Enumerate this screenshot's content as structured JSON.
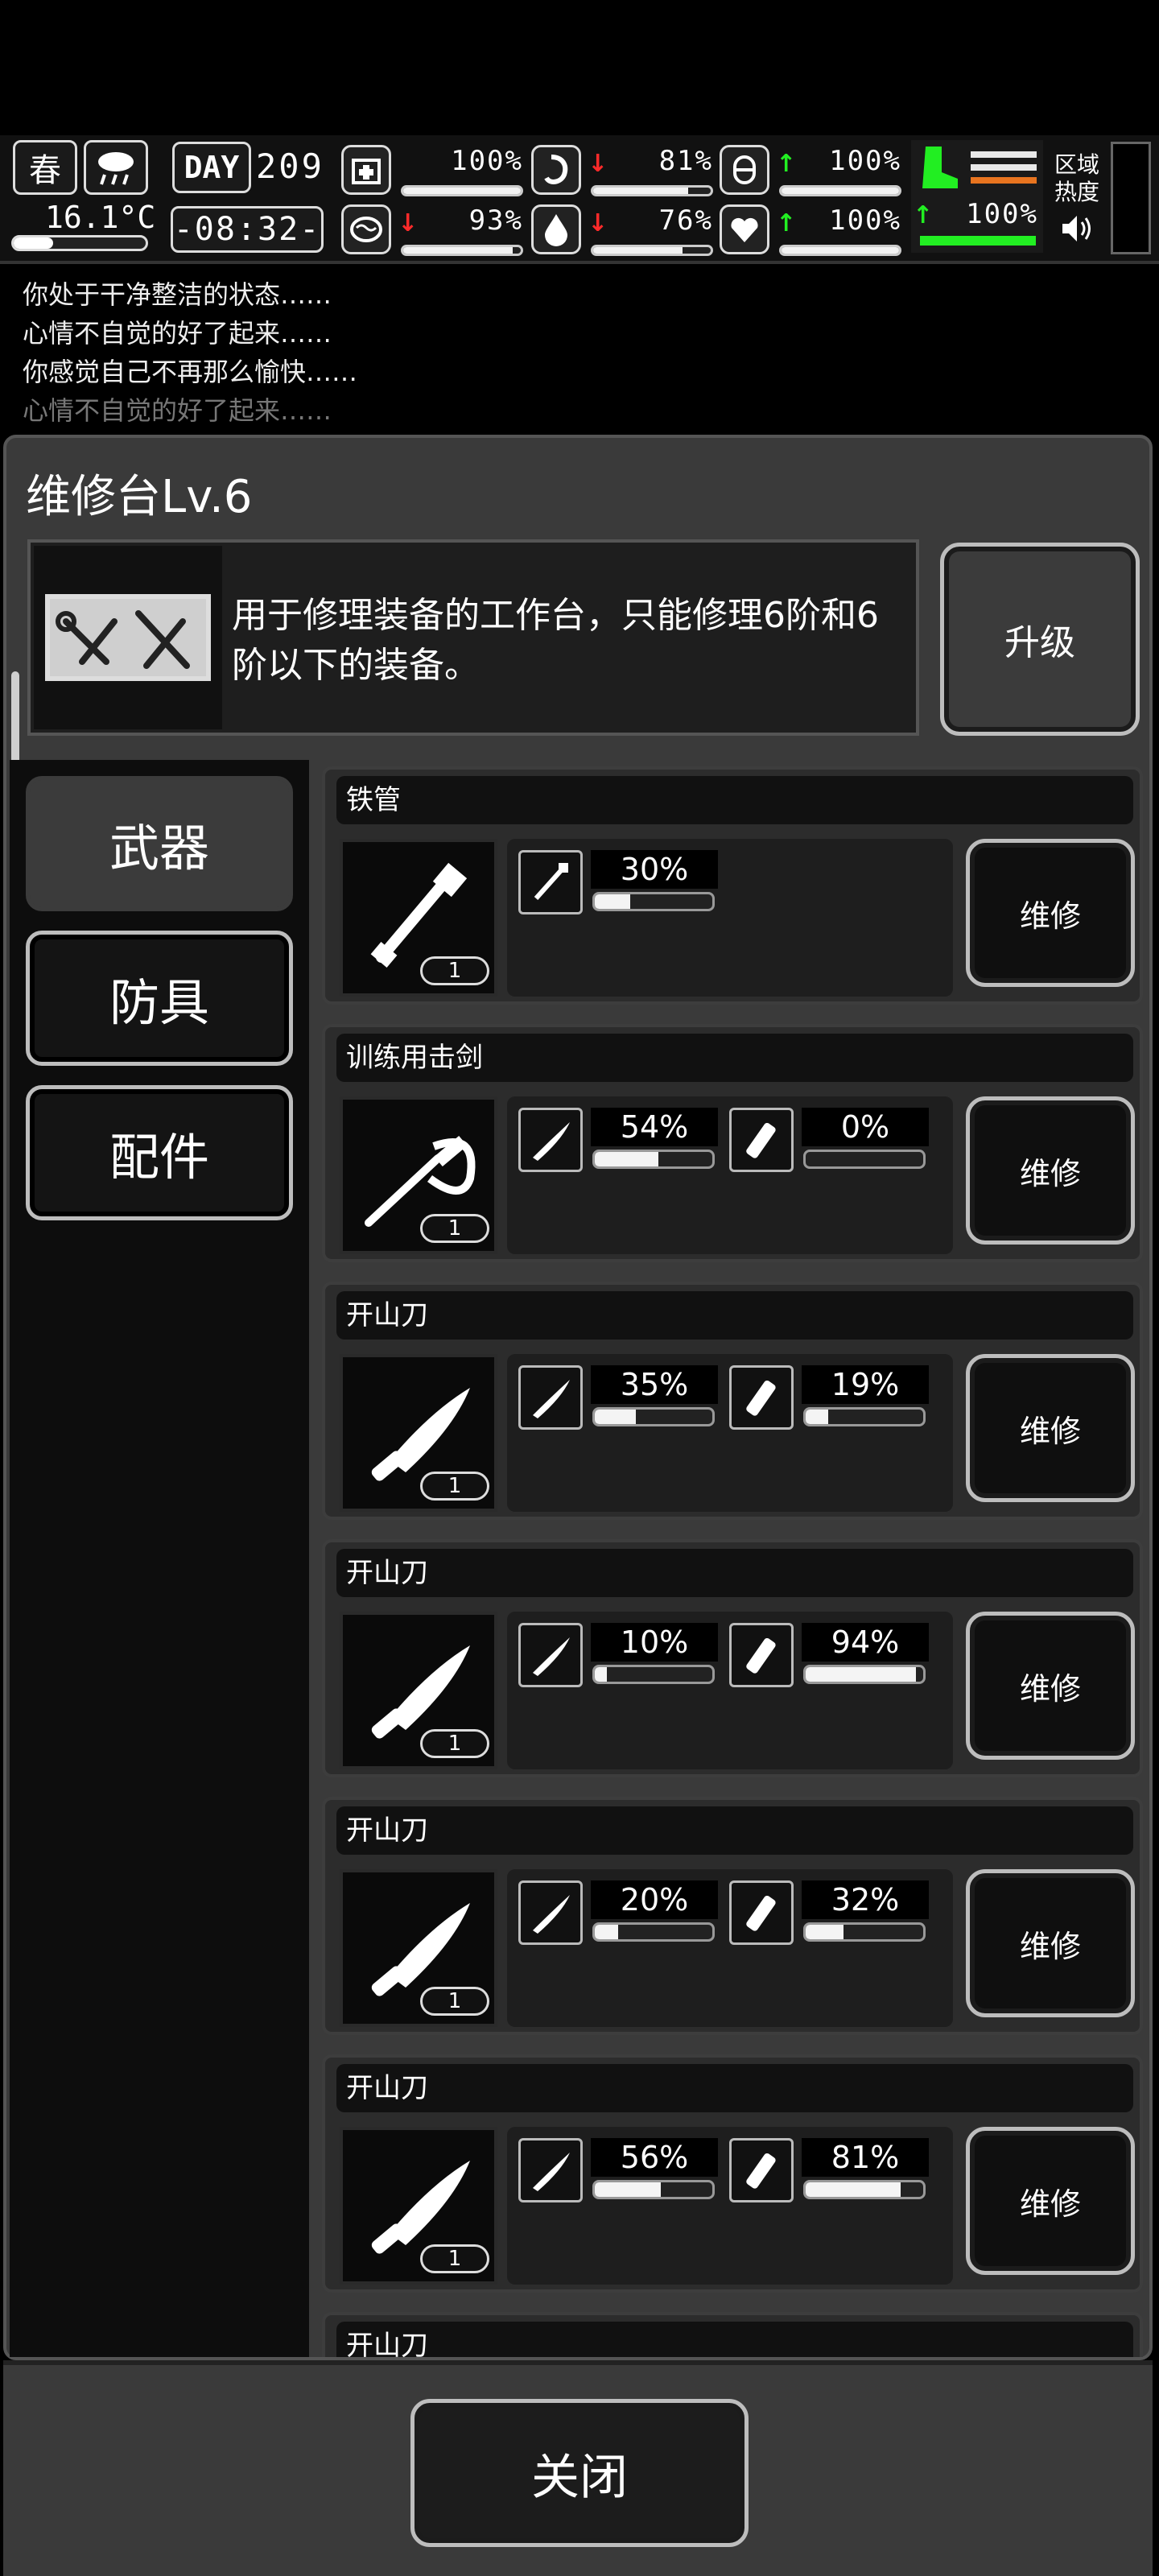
{
  "hud": {
    "season": "春",
    "day_label": "DAY",
    "day_number": "209",
    "temperature": "16.1°C",
    "clock": "-08:32-",
    "zone_heat_label": "区域\n热度",
    "stats": [
      {
        "icon": "medkit-icon",
        "arrow": "",
        "arrow_color": "",
        "value": "100%",
        "level": 1.0
      },
      {
        "icon": "stomach-icon",
        "arrow": "↓",
        "arrow_color": "#ff2a2a",
        "value": "81%",
        "level": 0.81
      },
      {
        "icon": "capsule-icon",
        "arrow": "↑",
        "arrow_color": "#22ee22",
        "value": "100%",
        "level": 1.0
      },
      {
        "icon": "brain-icon",
        "arrow": "↓",
        "arrow_color": "#ff2a2a",
        "value": "93%",
        "level": 0.93
      },
      {
        "icon": "water-drop-icon",
        "arrow": "↓",
        "arrow_color": "#ff2a2a",
        "value": "76%",
        "level": 0.76
      },
      {
        "icon": "heart-icon",
        "arrow": "↑",
        "arrow_color": "#22ee22",
        "value": "100%",
        "level": 1.0
      }
    ],
    "stamina": {
      "arrow": "↑",
      "value": "100%",
      "level": 1.0
    },
    "colors": {
      "green": "#22ee22",
      "red": "#ff2a2a",
      "orange": "#e8741f"
    }
  },
  "log": [
    "你处于干净整洁的状态……",
    "心情不自觉的好了起来……",
    "你感觉自己不再那么愉快……",
    "心情不自觉的好了起来……"
  ],
  "panel": {
    "title": "维修台Lv.6",
    "description": "用于修理装备的工作台，只能修理6阶和6阶以下的装备。",
    "upgrade_label": "升级"
  },
  "tabs": [
    {
      "label": "武器",
      "active": true
    },
    {
      "label": "防具",
      "active": false
    },
    {
      "label": "配件",
      "active": false
    }
  ],
  "items": [
    {
      "name": "铁管",
      "count": "1",
      "weapon_icon": "iron-pipe-icon",
      "durability": [
        {
          "icon": "pipe-part-icon",
          "value": "30%",
          "level": 0.3
        }
      ]
    },
    {
      "name": "训练用击剑",
      "count": "1",
      "weapon_icon": "fencing-sword-icon",
      "durability": [
        {
          "icon": "blade-part-icon",
          "value": "54%",
          "level": 0.54
        },
        {
          "icon": "grip-part-icon",
          "value": "0%",
          "level": 0.0
        }
      ]
    },
    {
      "name": "开山刀",
      "count": "1",
      "weapon_icon": "machete-icon",
      "durability": [
        {
          "icon": "blade-part-icon",
          "value": "35%",
          "level": 0.35
        },
        {
          "icon": "grip-part-icon",
          "value": "19%",
          "level": 0.19
        }
      ]
    },
    {
      "name": "开山刀",
      "count": "1",
      "weapon_icon": "machete-icon",
      "durability": [
        {
          "icon": "blade-part-icon",
          "value": "10%",
          "level": 0.1
        },
        {
          "icon": "grip-part-icon",
          "value": "94%",
          "level": 0.94
        }
      ]
    },
    {
      "name": "开山刀",
      "count": "1",
      "weapon_icon": "machete-icon",
      "durability": [
        {
          "icon": "blade-part-icon",
          "value": "20%",
          "level": 0.2
        },
        {
          "icon": "grip-part-icon",
          "value": "32%",
          "level": 0.32
        }
      ]
    },
    {
      "name": "开山刀",
      "count": "1",
      "weapon_icon": "machete-icon",
      "durability": [
        {
          "icon": "blade-part-icon",
          "value": "56%",
          "level": 0.56
        },
        {
          "icon": "grip-part-icon",
          "value": "81%",
          "level": 0.81
        }
      ]
    },
    {
      "name": "开山刀",
      "count": "",
      "weapon_icon": "machete-icon",
      "durability": []
    }
  ],
  "repair_label": "维修",
  "close_label": "关闭"
}
